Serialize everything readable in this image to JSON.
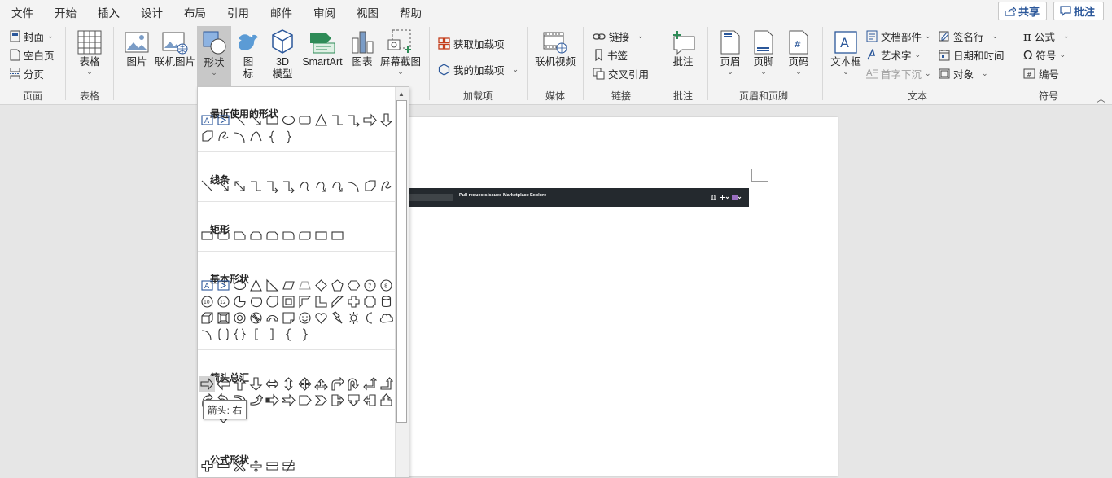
{
  "tabs": [
    "文件",
    "开始",
    "插入",
    "设计",
    "布局",
    "引用",
    "邮件",
    "审阅",
    "视图",
    "帮助"
  ],
  "active_tab": "插入",
  "share_label": "共享",
  "comments_label": "批注",
  "groups": {
    "pages": {
      "label": "页面",
      "cover": "封面",
      "blank": "空白页",
      "break": "分页"
    },
    "tables": {
      "label": "表格",
      "table": "表格"
    },
    "illustrations": {
      "picture": "图片",
      "online_picture": "联机图片",
      "shapes": "形状",
      "icons_line1": "图",
      "icons_line2": "标",
      "model_line1": "3D",
      "model_line2": "模型",
      "smartart": "SmartArt",
      "chart": "图表",
      "screenshot": "屏幕截图"
    },
    "addins": {
      "label": "加载项",
      "get": "获取加载项",
      "mine": "我的加载项"
    },
    "media": {
      "label": "媒体",
      "video": "联机视频"
    },
    "links": {
      "label": "链接",
      "link": "链接",
      "bookmark": "书签",
      "crossref": "交叉引用"
    },
    "comments": {
      "label": "批注",
      "comment": "批注"
    },
    "header_footer": {
      "label": "页眉和页脚",
      "header": "页眉",
      "footer": "页脚",
      "page_number": "页码"
    },
    "text": {
      "label": "文本",
      "textbox": "文本框",
      "quick_parts": "文档部件",
      "wordart": "艺术字",
      "dropcap": "首字下沉",
      "signature": "签名行",
      "datetime": "日期和时间",
      "object": "对象"
    },
    "symbols": {
      "label": "符号",
      "equation": "公式",
      "symbol": "符号",
      "numbering": "编号"
    }
  },
  "gallery": {
    "sections": [
      "最近使用的形状",
      "线条",
      "矩形",
      "基本形状",
      "箭头总汇",
      "公式形状"
    ],
    "tooltip": "箭头: 右"
  },
  "document": {
    "screenshot_links": [
      "Pull requests",
      "Issues",
      "Marketplace",
      "Explore"
    ]
  },
  "colors": {
    "accent": "#2b579a",
    "ribbon": "#f3f3f3",
    "canvas": "#e6e6e6"
  }
}
